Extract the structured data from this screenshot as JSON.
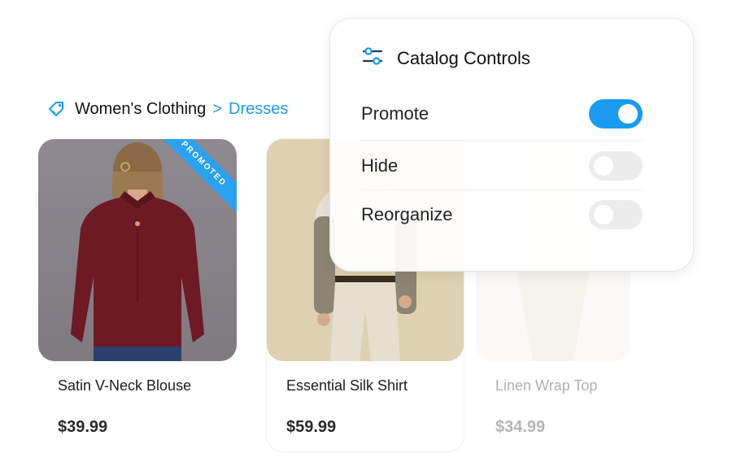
{
  "breadcrumb": {
    "icon": "tag-icon",
    "category": "Women's Clothing",
    "separator": ">",
    "current": "Dresses"
  },
  "products": [
    {
      "name": "Satin V-Neck Blouse",
      "price": "$39.99",
      "badge": "PROMOTED"
    },
    {
      "name": "Essential Silk Shirt",
      "price": "$59.99"
    },
    {
      "name": "Linen Wrap Top",
      "price": "$34.99"
    }
  ],
  "panel": {
    "icon": "sliders-icon",
    "title": "Catalog Controls",
    "controls": [
      {
        "label": "Promote",
        "state": "on"
      },
      {
        "label": "Hide",
        "state": "off"
      },
      {
        "label": "Reorganize",
        "state": "off"
      }
    ]
  },
  "colors": {
    "accent": "#1a9bf0",
    "blouse": "#6e1a24",
    "toggle_off": "#ececec"
  }
}
